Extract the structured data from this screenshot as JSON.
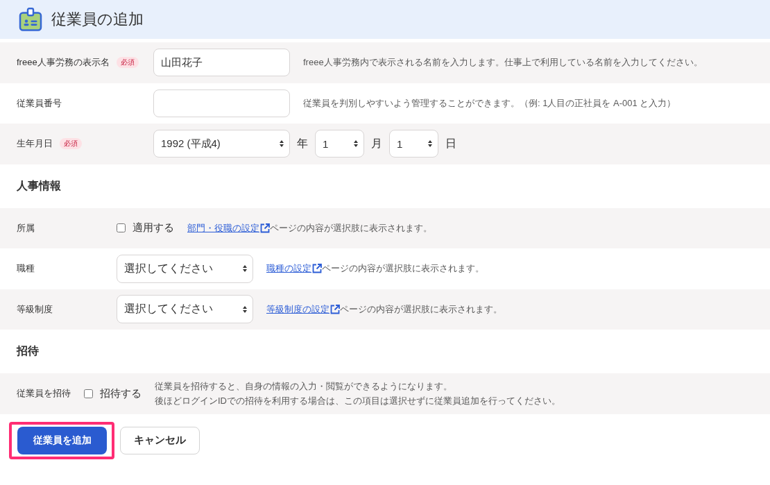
{
  "header": {
    "title": "従業員の追加"
  },
  "fields": [
    {
      "kind": "text",
      "label": "freee人事労務の表示名",
      "badge": "必須",
      "value": "山田花子",
      "hint": "freee人事労務内で表示される名前を入力します。仕事上で利用している名前を入力してください。"
    },
    {
      "kind": "text",
      "label": "従業員番号",
      "hint": "従業員を判別しやすいよう管理することができます。（例: 1人目の正社員を A-001 と入力）"
    },
    {
      "kind": "date",
      "label": "生年月日",
      "badge": "必須",
      "selects": [
        {
          "value": "1992 (平成4)",
          "unit": "年"
        },
        {
          "value": "1",
          "unit": "月"
        },
        {
          "value": "1",
          "unit": "日"
        }
      ]
    }
  ],
  "sections": [
    {
      "title": "人事情報",
      "rows": [
        {
          "kind": "checkbox",
          "label": "所属",
          "option": "適用する",
          "checked": false,
          "link": "部門・役職の設定",
          "note": "ページの内容が選択肢に表示されます。"
        },
        {
          "kind": "select",
          "label": "職種",
          "value": "選択してください",
          "link": "職種の設定",
          "note": "ページの内容が選択肢に表示されます。"
        },
        {
          "kind": "select",
          "label": "等級制度",
          "value": "選択してください",
          "link": "等級制度の設定",
          "note": "ページの内容が選択肢に表示されます。"
        }
      ]
    },
    {
      "title": "招待",
      "rows": [
        {
          "kind": "checkbox",
          "label": "従業員を招待",
          "option": "招待する",
          "checked": false,
          "hint_lines": [
            "従業員を招待すると、自身の情報の入力・閲覧ができるようになります。",
            "後ほどログインIDでの招待を利用する場合は、この項目は選択せずに従業員追加を行ってください。"
          ]
        }
      ]
    }
  ],
  "buttons": [
    {
      "kind": "primary",
      "label": "従業員を追加",
      "highlighted": true
    },
    {
      "kind": "secondary",
      "label": "キャンセル",
      "highlighted": false
    }
  ]
}
